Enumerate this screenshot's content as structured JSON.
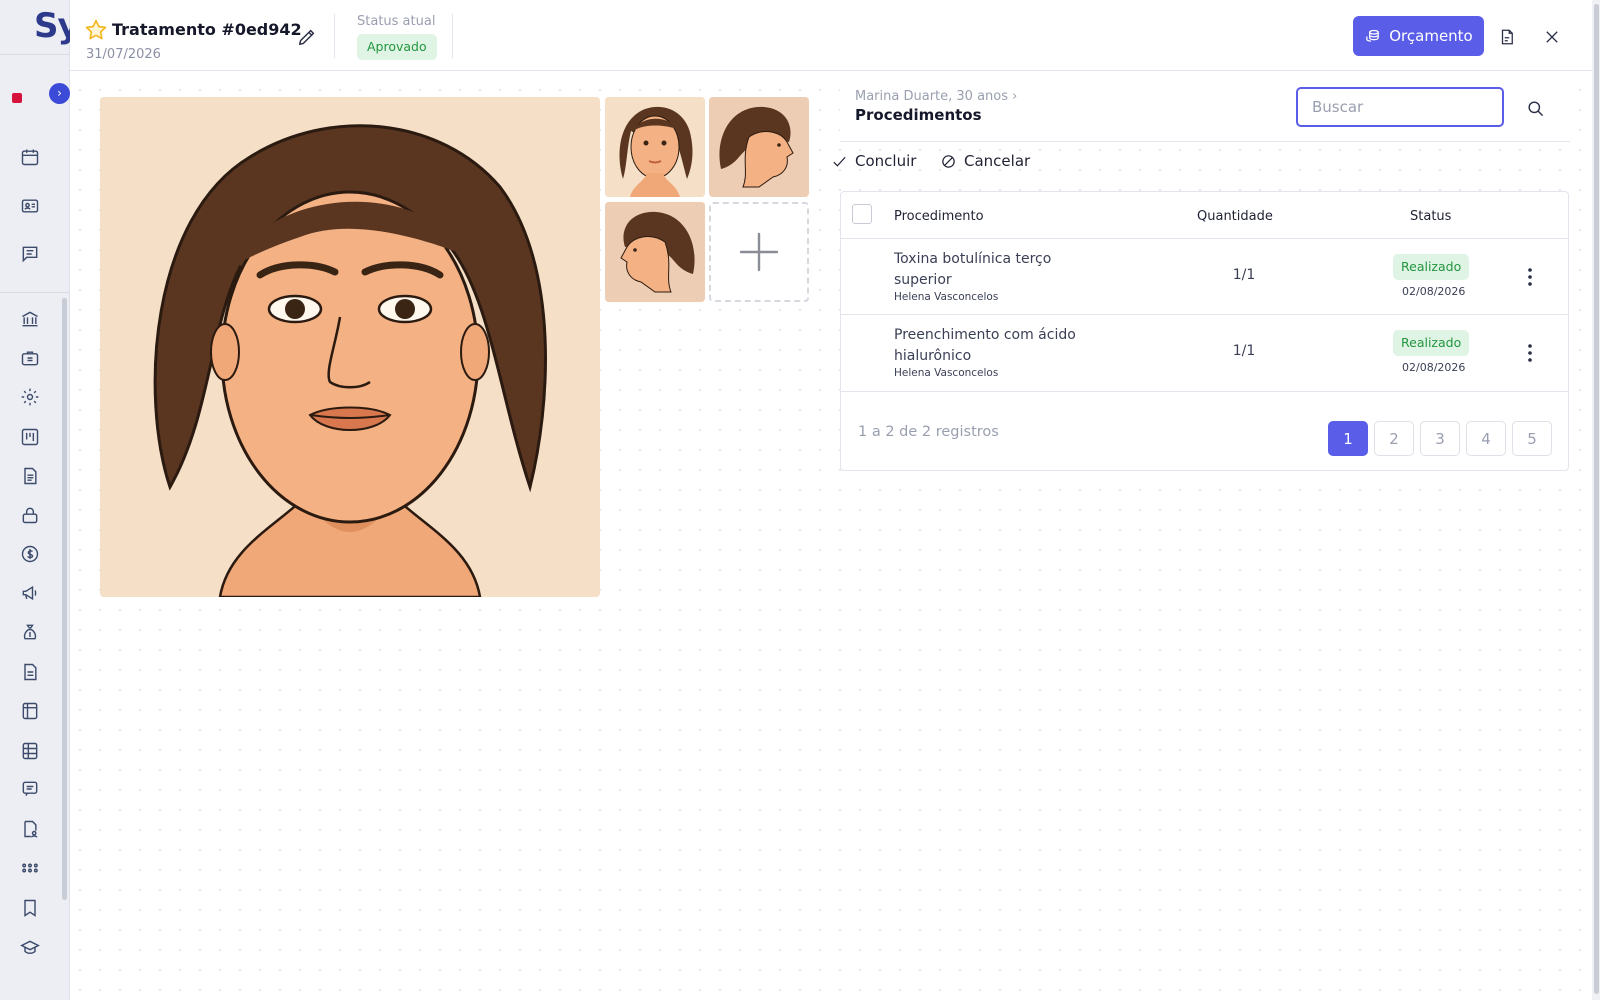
{
  "app": {
    "logo": "Sy"
  },
  "header": {
    "title": "Tratamento #0ed942",
    "date": "31/07/2026",
    "status_label": "Status atual",
    "status_value": "Aprovado",
    "budget_button": "Orçamento"
  },
  "panel": {
    "breadcrumb": "Marina Duarte, 30 anos",
    "breadcrumb_chevron": "›",
    "title": "Procedimentos",
    "search_placeholder": "Buscar",
    "actions": {
      "complete": "Concluir",
      "cancel": "Cancelar"
    }
  },
  "table": {
    "columns": {
      "procedure": "Procedimento",
      "quantity": "Quantidade",
      "status": "Status"
    },
    "rows": [
      {
        "procedure": "Toxina botulínica terço superior",
        "doctor": "Helena Vasconcelos",
        "quantity": "1/1",
        "status": "Realizado",
        "date": "02/08/2026"
      },
      {
        "procedure": "Preenchimento com ácido hialurônico",
        "doctor": "Helena Vasconcelos",
        "quantity": "1/1",
        "status": "Realizado",
        "date": "02/08/2026"
      }
    ],
    "records": "1 a 2 de 2 registros",
    "pages": [
      "1",
      "2",
      "3",
      "4",
      "5"
    ],
    "current_page": "1"
  },
  "colors": {
    "accent": "#5a5de8",
    "success_bg": "#dff4e5",
    "success_text": "#23963f",
    "sidebar_dot": "#d6133a"
  }
}
